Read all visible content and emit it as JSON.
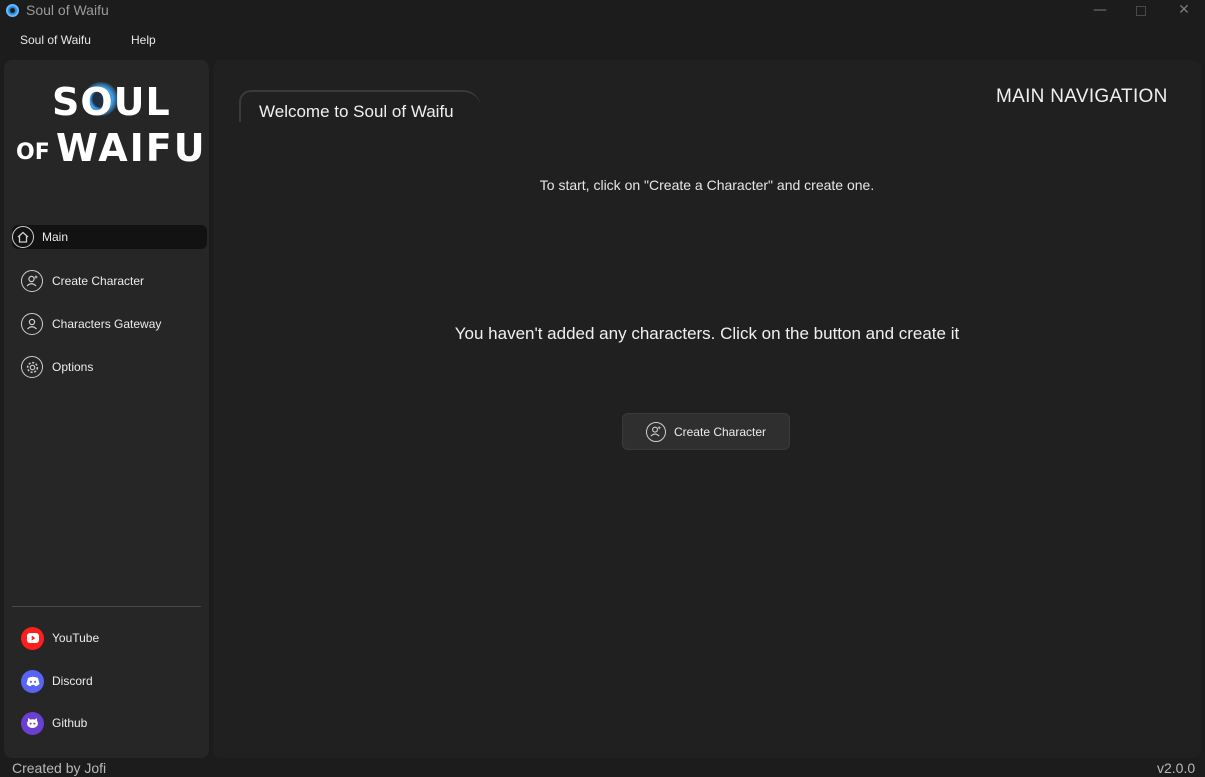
{
  "window": {
    "title": "Soul of Waifu",
    "minimize": "—",
    "close": "✕"
  },
  "menu": [
    {
      "label": "Soul of Waifu"
    },
    {
      "label": "Help"
    }
  ],
  "logo": {
    "line1": "SOUL",
    "line2a": "OF",
    "line2b": "WAIFU"
  },
  "sidebar": {
    "nav": [
      {
        "label": "Main",
        "icon": "home-icon",
        "active": true
      },
      {
        "label": "Create Character",
        "icon": "add-user-icon"
      },
      {
        "label": "Characters Gateway",
        "icon": "user-circle-icon"
      },
      {
        "label": "Options",
        "icon": "gear-icon"
      }
    ],
    "social": [
      {
        "label": "YouTube",
        "icon": "youtube-icon",
        "color": "#ff1e1e"
      },
      {
        "label": "Discord",
        "icon": "discord-icon",
        "color": "#5865f2"
      },
      {
        "label": "Github",
        "icon": "github-icon",
        "color": "#6a3fd1"
      }
    ]
  },
  "main": {
    "welcome": "Welcome to Soul of Waifu",
    "section_label": "MAIN NAVIGATION",
    "hint": "To start, click on \"Create a Character\" and create one.",
    "empty_message": "You haven't added any characters. Click on the button and create it",
    "create_button": "Create Character"
  },
  "status": {
    "left": "Created by Jofi",
    "version": "v2.0.0"
  },
  "colors": {
    "background": "#1c1c1c",
    "sidebar": "#262626",
    "panel": "#202020",
    "accent": "#3fa9ff"
  }
}
